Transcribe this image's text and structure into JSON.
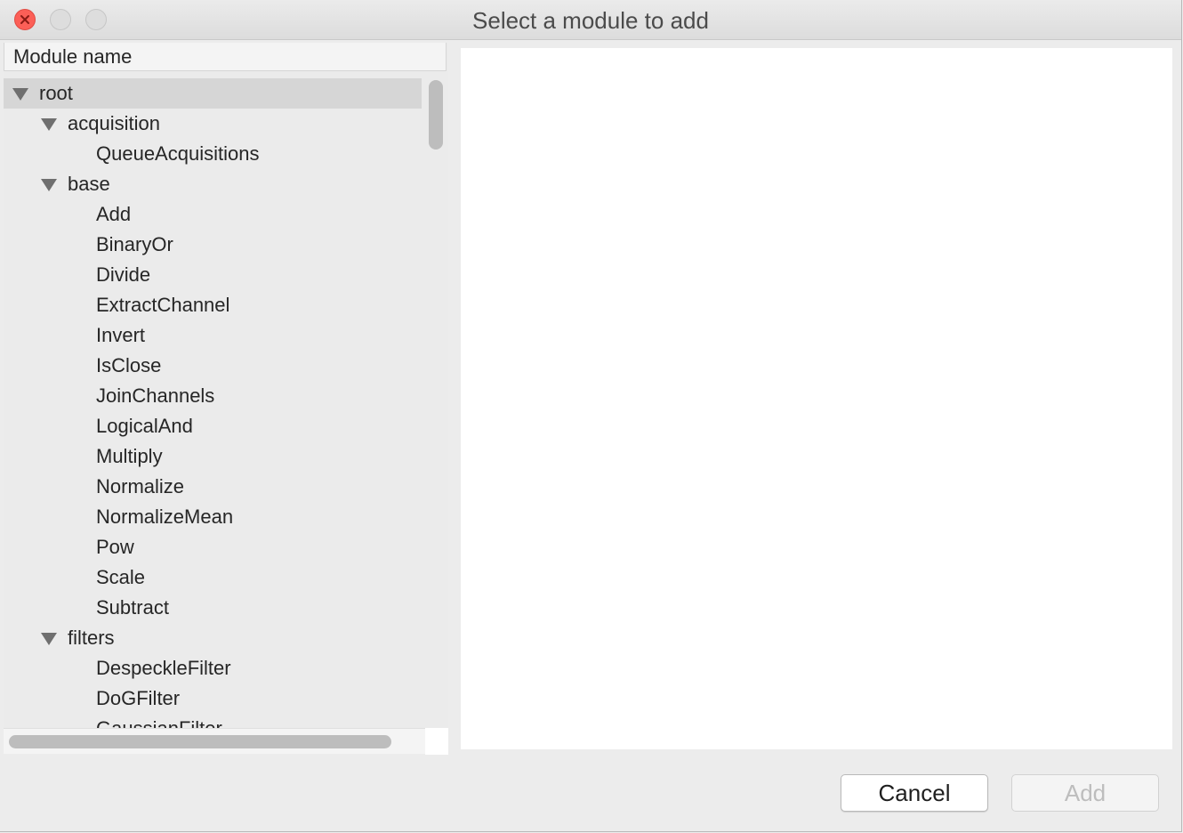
{
  "window": {
    "title": "Select a module to add"
  },
  "tree": {
    "column_header": "Module name",
    "rows": [
      {
        "label": "root",
        "expanded": true,
        "selected": true
      },
      {
        "label": "acquisition",
        "expanded": true
      },
      {
        "label": "QueueAcquisitions"
      },
      {
        "label": "base",
        "expanded": true
      },
      {
        "label": "Add"
      },
      {
        "label": "BinaryOr"
      },
      {
        "label": "Divide"
      },
      {
        "label": "ExtractChannel"
      },
      {
        "label": "Invert"
      },
      {
        "label": "IsClose"
      },
      {
        "label": "JoinChannels"
      },
      {
        "label": "LogicalAnd"
      },
      {
        "label": "Multiply"
      },
      {
        "label": "Normalize"
      },
      {
        "label": "NormalizeMean"
      },
      {
        "label": "Pow"
      },
      {
        "label": "Scale"
      },
      {
        "label": "Subtract"
      },
      {
        "label": "filters",
        "expanded": true
      },
      {
        "label": "DespeckleFilter"
      },
      {
        "label": "DoGFilter"
      },
      {
        "label": "GaussianFilter"
      }
    ]
  },
  "buttons": {
    "cancel": "Cancel",
    "add": "Add",
    "add_enabled": false
  },
  "colors": {
    "close_button": "#fc5f57",
    "selection": "#d6d6d6",
    "detail_background": "#ffffff"
  }
}
